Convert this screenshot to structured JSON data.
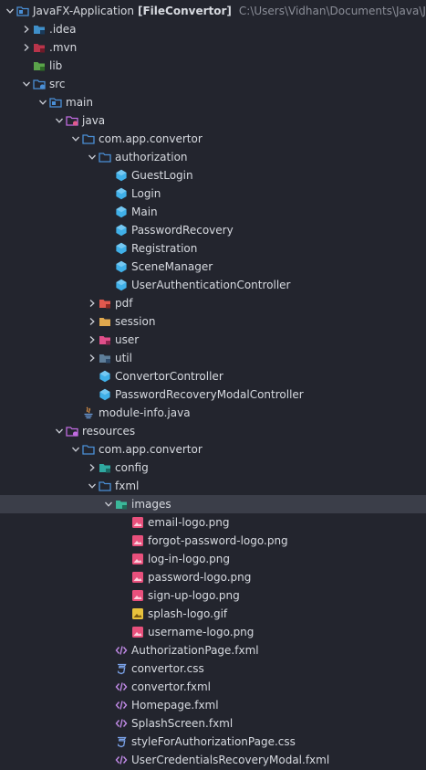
{
  "tree": [
    {
      "label": "JavaFX-Application",
      "extra": "[FileConvertor]",
      "path": "C:\\Users\\Vidhan\\Documents\\Java\\JavaFX-A",
      "depth": 0,
      "arrow": "down",
      "icon": "module",
      "name": "project-root"
    },
    {
      "label": ".idea",
      "depth": 1,
      "arrow": "right",
      "icon": "folder-idea",
      "name": "folder-idea"
    },
    {
      "label": ".mvn",
      "depth": 1,
      "arrow": "right",
      "icon": "folder-mvn",
      "name": "folder-mvn"
    },
    {
      "label": "lib",
      "depth": 1,
      "arrow": "none",
      "icon": "folder-lib",
      "name": "folder-lib"
    },
    {
      "label": "src",
      "depth": 1,
      "arrow": "down",
      "icon": "folder-src",
      "name": "folder-src"
    },
    {
      "label": "main",
      "depth": 2,
      "arrow": "down",
      "icon": "folder-main",
      "name": "folder-main"
    },
    {
      "label": "java",
      "depth": 3,
      "arrow": "down",
      "icon": "folder-java",
      "name": "folder-java"
    },
    {
      "label": "com.app.convertor",
      "depth": 4,
      "arrow": "down",
      "icon": "folder-pkg",
      "name": "package-com-app-convertor"
    },
    {
      "label": "authorization",
      "depth": 5,
      "arrow": "down",
      "icon": "folder-pkg",
      "name": "package-authorization"
    },
    {
      "label": "GuestLogin",
      "depth": 6,
      "arrow": "none",
      "icon": "class",
      "name": "class-guestlogin"
    },
    {
      "label": "Login",
      "depth": 6,
      "arrow": "none",
      "icon": "class",
      "name": "class-login"
    },
    {
      "label": "Main",
      "depth": 6,
      "arrow": "none",
      "icon": "class",
      "name": "class-main"
    },
    {
      "label": "PasswordRecovery",
      "depth": 6,
      "arrow": "none",
      "icon": "class",
      "name": "class-passwordrecovery"
    },
    {
      "label": "Registration",
      "depth": 6,
      "arrow": "none",
      "icon": "class",
      "name": "class-registration"
    },
    {
      "label": "SceneManager",
      "depth": 6,
      "arrow": "none",
      "icon": "class",
      "name": "class-scenemanager"
    },
    {
      "label": "UserAuthenticationController",
      "depth": 6,
      "arrow": "none",
      "icon": "class",
      "name": "class-userauthenticationcontroller"
    },
    {
      "label": "pdf",
      "depth": 5,
      "arrow": "right",
      "icon": "folder-pdf",
      "name": "package-pdf"
    },
    {
      "label": "session",
      "depth": 5,
      "arrow": "right",
      "icon": "folder-session",
      "name": "package-session"
    },
    {
      "label": "user",
      "depth": 5,
      "arrow": "right",
      "icon": "folder-user",
      "name": "package-user"
    },
    {
      "label": "util",
      "depth": 5,
      "arrow": "right",
      "icon": "folder-util",
      "name": "package-util"
    },
    {
      "label": "ConvertorController",
      "depth": 5,
      "arrow": "none",
      "icon": "class",
      "name": "class-convertorcontroller"
    },
    {
      "label": "PasswordRecoveryModalController",
      "depth": 5,
      "arrow": "none",
      "icon": "class",
      "name": "class-passwordrecoverymodalcontroller"
    },
    {
      "label": "module-info.java",
      "depth": 4,
      "arrow": "none",
      "icon": "java-file",
      "name": "file-module-info"
    },
    {
      "label": "resources",
      "depth": 3,
      "arrow": "down",
      "icon": "folder-resources",
      "name": "folder-resources"
    },
    {
      "label": "com.app.convertor",
      "depth": 4,
      "arrow": "down",
      "icon": "folder-pkg",
      "name": "resources-com-app-convertor"
    },
    {
      "label": "config",
      "depth": 5,
      "arrow": "right",
      "icon": "folder-config",
      "name": "folder-config"
    },
    {
      "label": "fxml",
      "depth": 5,
      "arrow": "down",
      "icon": "folder-pkg",
      "name": "folder-fxml"
    },
    {
      "label": "images",
      "depth": 6,
      "arrow": "down",
      "icon": "folder-images",
      "name": "folder-images",
      "selected": true
    },
    {
      "label": "email-logo.png",
      "depth": 7,
      "arrow": "none",
      "icon": "png",
      "name": "file-email-logo"
    },
    {
      "label": "forgot-password-logo.png",
      "depth": 7,
      "arrow": "none",
      "icon": "png",
      "name": "file-forgot-password-logo"
    },
    {
      "label": "log-in-logo.png",
      "depth": 7,
      "arrow": "none",
      "icon": "png",
      "name": "file-log-in-logo"
    },
    {
      "label": "password-logo.png",
      "depth": 7,
      "arrow": "none",
      "icon": "png",
      "name": "file-password-logo"
    },
    {
      "label": "sign-up-logo.png",
      "depth": 7,
      "arrow": "none",
      "icon": "png",
      "name": "file-sign-up-logo"
    },
    {
      "label": "splash-logo.gif",
      "depth": 7,
      "arrow": "none",
      "icon": "gif",
      "name": "file-splash-logo"
    },
    {
      "label": "username-logo.png",
      "depth": 7,
      "arrow": "none",
      "icon": "png",
      "name": "file-username-logo"
    },
    {
      "label": "AuthorizationPage.fxml",
      "depth": 6,
      "arrow": "none",
      "icon": "fxml",
      "name": "file-authorizationpage"
    },
    {
      "label": "convertor.css",
      "depth": 6,
      "arrow": "none",
      "icon": "css",
      "name": "file-convertor-css"
    },
    {
      "label": "convertor.fxml",
      "depth": 6,
      "arrow": "none",
      "icon": "fxml",
      "name": "file-convertor-fxml"
    },
    {
      "label": "Homepage.fxml",
      "depth": 6,
      "arrow": "none",
      "icon": "fxml",
      "name": "file-homepage"
    },
    {
      "label": "SplashScreen.fxml",
      "depth": 6,
      "arrow": "none",
      "icon": "fxml",
      "name": "file-splashscreen"
    },
    {
      "label": "styleForAuthorizationPage.css",
      "depth": 6,
      "arrow": "none",
      "icon": "css",
      "name": "file-styleforauthorizationpage"
    },
    {
      "label": "UserCredentialsRecoveryModal.fxml",
      "depth": 6,
      "arrow": "none",
      "icon": "fxml",
      "name": "file-usercredentialsrecoverymodal"
    }
  ],
  "colors": {
    "background": "#23252e",
    "selection": "#3b3e49",
    "text": "#d7dae0",
    "path": "#8b8e98",
    "folder": "#4a8fd6",
    "class": "#40b0e8",
    "png": "#e8507c",
    "gif": "#e8c23c",
    "fxml": "#c08ae6",
    "css": "#7aa2e8"
  }
}
